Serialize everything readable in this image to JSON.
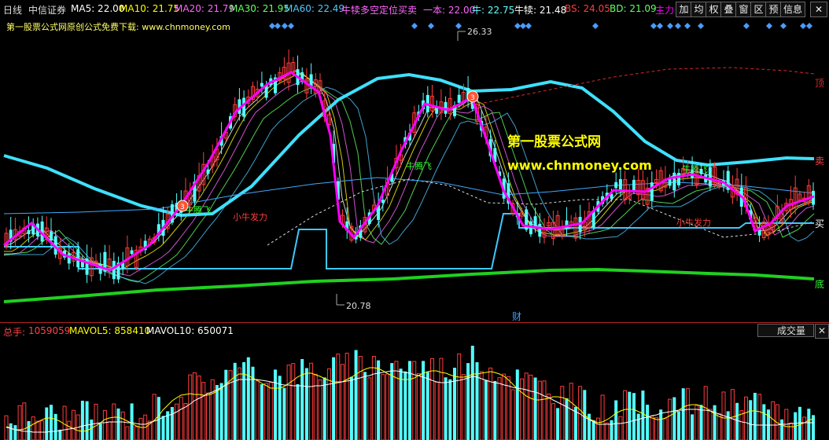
{
  "topbar": {
    "period": "日线",
    "stock_name": "中信证券",
    "ma5": "MA5: 22.00",
    "ma10": "MA10: 21.75",
    "ma20": "MA20: 21.79",
    "ma30": "MA30: 21.95",
    "ma60": "MA60: 22.49",
    "indicator_name": "牛犊多空定位买卖",
    "yiben": "一本: 22.00",
    "niu": "牛: 22.75",
    "niudu": "牛犊: 21.48",
    "bs": "BS: 24.05",
    "bd": "BD: 21.09",
    "zhuli": "主力",
    "buttons": [
      "加",
      "均",
      "权",
      "叠",
      "窗",
      "区",
      "预",
      "信息"
    ],
    "close": "✕"
  },
  "subtitle": "第一股票公式网原创公式免费下载: www.chnmoney.com",
  "watermark": {
    "name": "第一股票公式网",
    "url": "www.chnmoney.com"
  },
  "chart_labels": {
    "high_price": "26.33",
    "low_price": "20.78",
    "ding": "顶",
    "mai_sell": "卖",
    "mai_buy": "买",
    "di": "底",
    "cai": "财",
    "niu_teng_fei_1": "牛腾飞",
    "niu_teng_fei_2": "牛腾飞",
    "niu_teng_fei_3": "牛腾飞",
    "xiao_niu_1": "小牛发力",
    "xiao_niu_2": "小牛发力",
    "marker_1": "3",
    "marker_2": "3"
  },
  "volume": {
    "label": "总手:",
    "total": "1059059",
    "mavol5": "MAVOL5: 858410",
    "mavol10": "MAVOL10: 650071",
    "dropdown": "成交量",
    "close": "✕"
  },
  "colors": {
    "bg": "#000000",
    "up": "#ff3b3b",
    "down": "#54ffff",
    "niu_line": "#ff00ff",
    "envelope": "#3fe0ff",
    "bottom_line": "#1fd11f",
    "ma5": "#ffffff",
    "ma10": "#ffff00",
    "ma20": "#ff66ff",
    "ma30": "#66ff66",
    "ma60": "#4ec9ff",
    "ding_line": "#d22a2a"
  }
}
